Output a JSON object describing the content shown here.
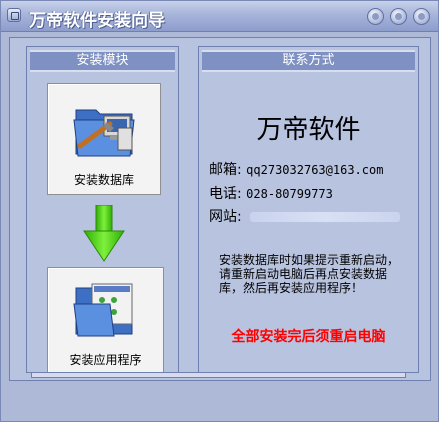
{
  "window": {
    "title": "万帝软件安装向导"
  },
  "modules": {
    "header": "安装模块",
    "install_database_label": "安装数据库",
    "install_app_label": "安装应用程序"
  },
  "contact": {
    "header": "联系方式",
    "brand": "万帝软件",
    "email_label": "邮箱:",
    "email_value": "qq273032763@163.com",
    "phone_label": "电话:",
    "phone_value": "028-80799773",
    "website_label": "网站:",
    "notice": "安装数据库时如果提示重新启动，请重新启动电脑后再点安装数据库，然后再安装应用程序！",
    "warning": "全部安装完后须重启电脑"
  },
  "icons": {
    "app": "app-icon",
    "minimize": "minimize-icon",
    "maximize": "maximize-icon",
    "close": "close-icon",
    "database": "database-folder-icon",
    "application": "application-folder-icon",
    "arrow": "arrow-down-icon"
  },
  "colors": {
    "window_bg": "#aeb9d8",
    "header_bg": "#7f90c2",
    "warning": "#ff0000",
    "arrow": "#4ccf14"
  }
}
